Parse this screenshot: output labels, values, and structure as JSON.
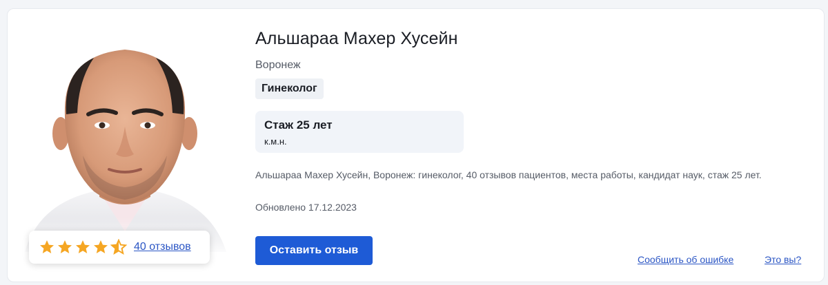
{
  "doctor": {
    "name": "Альшараа Махер Хусейн",
    "city": "Воронеж",
    "specialty": "Гинеколог",
    "experience_title": "Стаж 25 лет",
    "degree": "к.м.н.",
    "description": "Альшараа Махер Хусейн, Воронеж: гинеколог, 40 отзывов пациентов, места работы, кандидат наук, стаж 25 лет.",
    "updated": "Обновлено 17.12.2023"
  },
  "rating": {
    "stars": 4.5,
    "max_stars": 5,
    "reviews_link": "40 отзывов",
    "star_color": "#f5a623"
  },
  "actions": {
    "leave_review": "Оставить отзыв",
    "report_error": "Сообщить об ошибке",
    "is_you": "Это вы?"
  },
  "colors": {
    "accent": "#1e5bd6",
    "link": "#2a55c4"
  }
}
